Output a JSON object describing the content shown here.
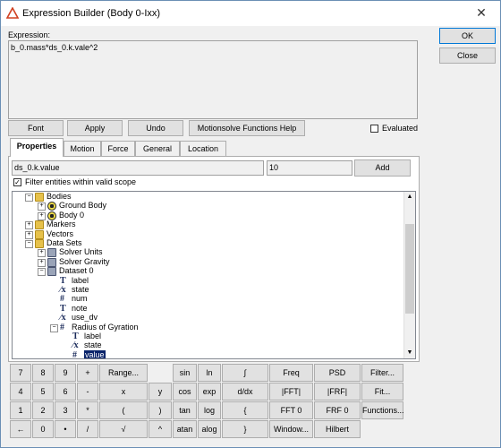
{
  "window": {
    "title": "Expression Builder (Body 0-Ixx)",
    "close_glyph": "✕"
  },
  "expression": {
    "label": "Expression:",
    "value": "b_0.mass*ds_0.k.vale^2"
  },
  "buttons": {
    "ok": "OK",
    "close": "Close"
  },
  "toolbar": {
    "font": "Font",
    "apply": "Apply",
    "undo": "Undo",
    "help": "Motionsolve Functions Help"
  },
  "evaluated": {
    "label": "Evaluated",
    "checked": false
  },
  "tabs": [
    "Properties",
    "Motion",
    "Force",
    "General",
    "Location"
  ],
  "properties": {
    "path_value": "ds_0.k.value",
    "num_value": "10",
    "add_label": "Add",
    "filter_label": "Filter entities within valid scope",
    "filter_checked": true
  },
  "tree": [
    {
      "label": "Bodies",
      "icon": "folder-icon",
      "exp": "−"
    },
    {
      "label": "Ground Body",
      "icon": "body-icon",
      "exp": "+"
    },
    {
      "label": "Body 0",
      "icon": "body-icon",
      "exp": "+"
    },
    {
      "label": "Markers",
      "icon": "folder-icon",
      "exp": "+"
    },
    {
      "label": "Vectors",
      "icon": "folder-icon",
      "exp": "+"
    },
    {
      "label": "Data Sets",
      "icon": "folder-icon",
      "exp": "−"
    },
    {
      "label": "Solver Units",
      "icon": "dataset-icon",
      "exp": "+"
    },
    {
      "label": "Solver Gravity",
      "icon": "dataset-icon",
      "exp": "+"
    },
    {
      "label": "Dataset 0",
      "icon": "dataset-icon",
      "exp": "−"
    },
    {
      "label": "label",
      "icon": "T",
      "exp": ""
    },
    {
      "label": "state",
      "icon": "⁄x",
      "exp": ""
    },
    {
      "label": "num",
      "icon": "#",
      "exp": ""
    },
    {
      "label": "note",
      "icon": "T",
      "exp": ""
    },
    {
      "label": "use_dv",
      "icon": "⁄x",
      "exp": ""
    },
    {
      "label": "Radius of Gyration",
      "icon": "#",
      "exp": "−"
    },
    {
      "label": "label",
      "icon": "T",
      "exp": ""
    },
    {
      "label": "state",
      "icon": "⁄x",
      "exp": ""
    },
    {
      "label": "value",
      "icon": "#",
      "exp": "",
      "selected": true
    }
  ],
  "keypad": [
    [
      "7",
      "8",
      "9",
      "+",
      "Range...",
      "sin",
      "ln",
      "∫",
      "Freq",
      "PSD",
      "Filter..."
    ],
    [
      "4",
      "5",
      "6",
      "-",
      "x",
      "y",
      "cos",
      "exp",
      "d/dx",
      "|FFT|",
      "|FRF|",
      "Fit..."
    ],
    [
      "1",
      "2",
      "3",
      "*",
      "(",
      ")",
      "tan",
      "log",
      "{",
      "FFT 0",
      "FRF 0",
      "Functions..."
    ],
    [
      "←",
      "0",
      "•",
      "/",
      "√",
      "^",
      "atan",
      "alog",
      "}",
      "Window...",
      "Hilbert"
    ]
  ]
}
